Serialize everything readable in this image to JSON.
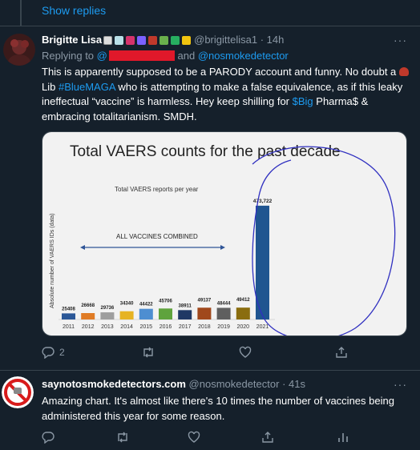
{
  "thread": {
    "show_replies": "Show replies"
  },
  "tweet1": {
    "author_name": "Brigitte Lisa",
    "handle": "@brigittelisa1",
    "time": "· 14h",
    "replying_prefix": "Replying to",
    "replying_at": "@",
    "replying_and": "and",
    "replying_to_2": "@nosmokedetector",
    "text_1": "This is apparently supposed to be a PARODY account and funny. No doubt a ",
    "text_2": " Lib ",
    "hashtag": "#BlueMAGA",
    "text_3": " who is attempting to make a false equivalence, as if this leaky ineffectual “vaccine” is harmless.  Hey keep shilling for ",
    "cashtag": "$Big",
    "text_4": " Pharma$ & embracing totalitarianism. SMDH.",
    "reply_count": "2",
    "more": "···"
  },
  "chart_data": {
    "type": "bar",
    "title": "Total VAERS counts for the past decade",
    "subtitle": "Total VAERS reports per year",
    "ylabel": "Absolute number of VAERS IDs (data)",
    "annotation": "ALL VACCINES COMBINED",
    "categories": [
      "2011",
      "2012",
      "2013",
      "2014",
      "2015",
      "2016",
      "2017",
      "2018",
      "2019",
      "2020",
      "2021"
    ],
    "values": [
      25408,
      26668,
      29736,
      34340,
      44422,
      45706,
      38911,
      49137,
      48444,
      49412,
      473722
    ],
    "data_labels": [
      "25408",
      "26668",
      "29736",
      "34340",
      "44422",
      "45706",
      "38911",
      "49137",
      "48444",
      "49412",
      "473,722"
    ],
    "colors": [
      "#2b5797",
      "#e07b25",
      "#9e9e9e",
      "#e6b322",
      "#4e8ed1",
      "#5fa33d",
      "#1f3864",
      "#a0481c",
      "#5f5f5f",
      "#8a6d0f",
      "#1f5590"
    ],
    "ylim": [
      0,
      500000
    ]
  },
  "tweet2": {
    "author_name": "saynotosmokedetectors.com",
    "handle": "@nosmokedetector",
    "time": "· 41s",
    "text": "Amazing chart. It's almost like there's 10 times the number of vaccines being administered this year for some reason.",
    "more": "···"
  },
  "colors": {
    "background": "#15202b",
    "accent": "#1d9bf0",
    "muted": "#8b98a5",
    "divider": "#38444d"
  }
}
